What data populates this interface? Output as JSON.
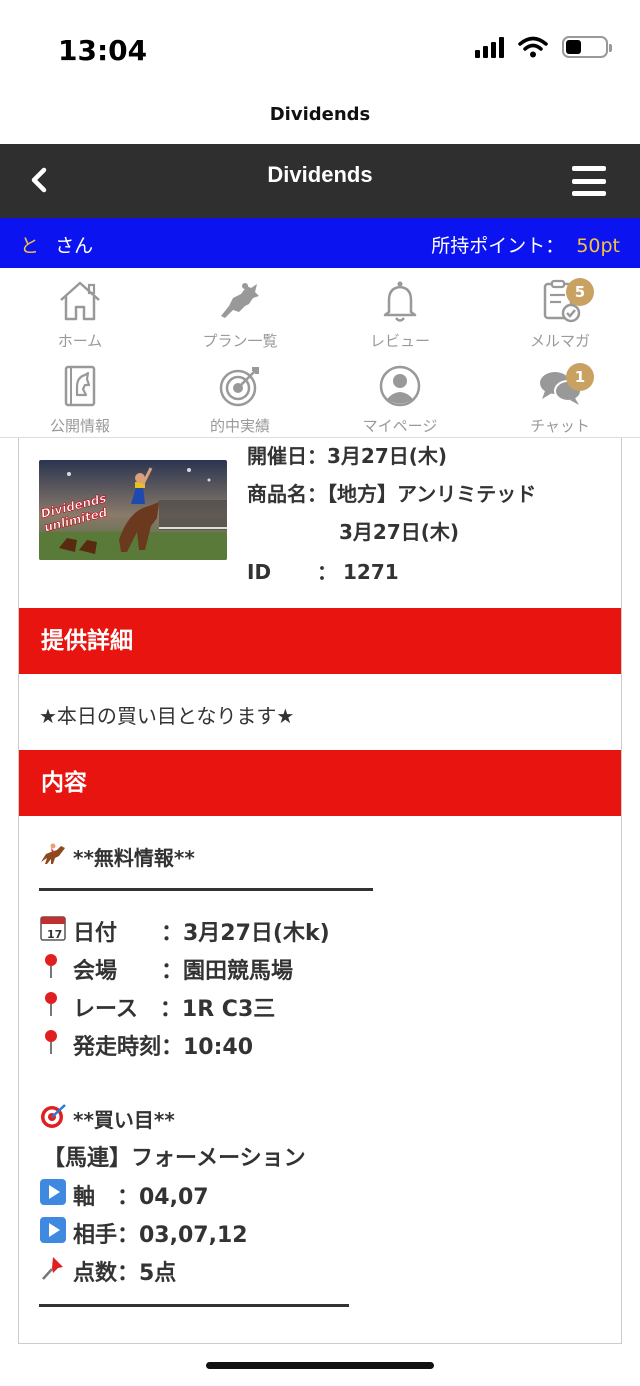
{
  "status": {
    "time": "13:04"
  },
  "browser": {
    "title": "Dividends"
  },
  "header": {
    "title": "Dividends"
  },
  "user": {
    "name_part1": "と",
    "name_part2": "さん",
    "points_label": "所持ポイント：",
    "points_value": "50pt"
  },
  "nav": {
    "items": [
      {
        "label": "ホーム",
        "icon": "home-icon"
      },
      {
        "label": "プラン一覧",
        "icon": "horse-icon"
      },
      {
        "label": "レビュー",
        "icon": "bell-icon"
      },
      {
        "label": "メルマガ",
        "icon": "clipboard-check-icon",
        "badge": "5"
      },
      {
        "label": "公開情報",
        "icon": "book-horse-icon"
      },
      {
        "label": "的中実績",
        "icon": "target-icon"
      },
      {
        "label": "マイページ",
        "icon": "user-icon"
      },
      {
        "label": "チャット",
        "icon": "chat-icon",
        "badge": "1"
      }
    ]
  },
  "product": {
    "date_label": "開催日：",
    "date_value": "3月27日(木)",
    "name_label": "商品名：",
    "name_value": "【地方】アンリミテッド",
    "name_value_line2": "3月27日(木)",
    "id_label": "ID",
    "id_sep": "：",
    "id_value": "1271",
    "image_text": "Dividends unlimited"
  },
  "details": {
    "heading": "提供詳細",
    "text": "★本日の買い目となります★"
  },
  "contents": {
    "heading": "内容",
    "free_info": "**無料情報**",
    "date_line": "日付　　：3月27日(木k)",
    "venue_line": "会場　　：園田競馬場",
    "race_line": "レース　：1R  C3三",
    "time_line": "発走時刻：10:40",
    "buy_title": "**買い目**",
    "type_line": "【馬連】フォーメーション",
    "axis_line": "軸　：04,07",
    "partner_line": "相手：03,07,12",
    "count_line": "点数：5点"
  },
  "colors": {
    "header_bg": "#2f2f2f",
    "user_bar": "#0a13f0",
    "section_red": "#e8140f",
    "badge": "#c9a262",
    "accent_yellow": "#f5c242"
  }
}
